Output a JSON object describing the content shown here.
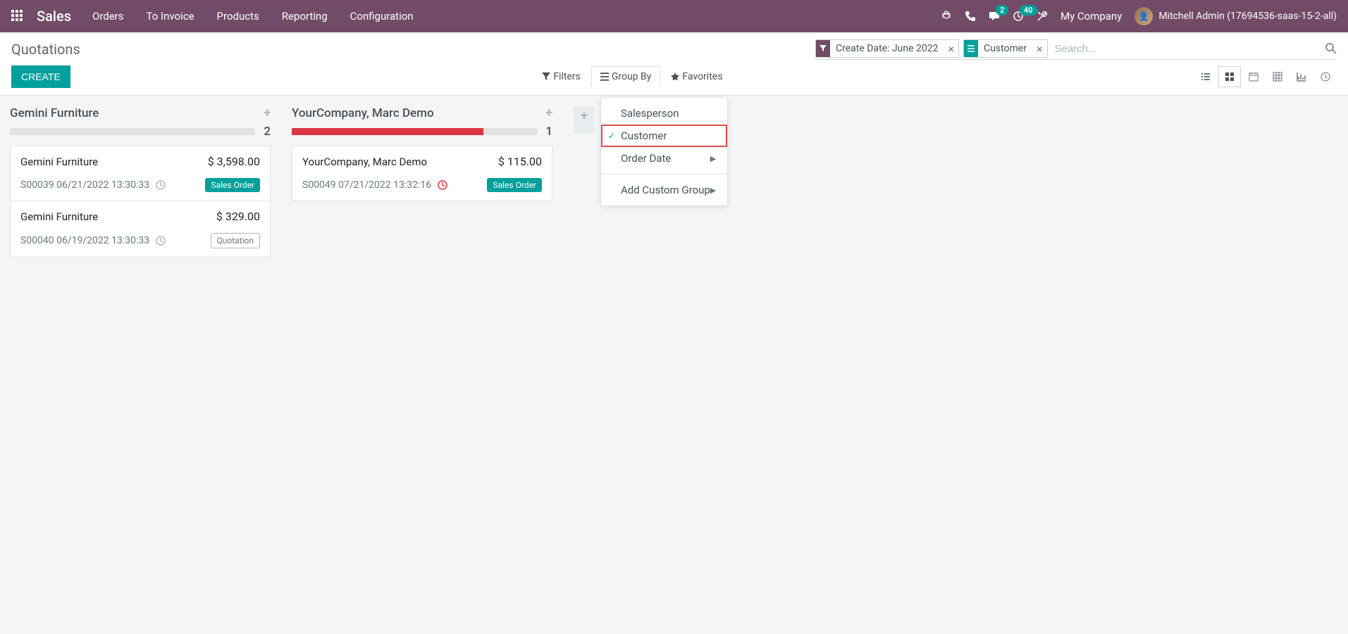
{
  "nav": {
    "brand": "Sales",
    "menu": [
      "Orders",
      "To Invoice",
      "Products",
      "Reporting",
      "Configuration"
    ],
    "messages_badge": "2",
    "activities_badge": "40",
    "company": "My Company",
    "user": "Mitchell Admin (17694536-saas-15-2-all)"
  },
  "control": {
    "title": "Quotations",
    "create": "CREATE",
    "filters": "Filters",
    "groupby": "Group By",
    "favorites": "Favorites",
    "search_placeholder": "Search...",
    "facets": [
      {
        "type": "filter",
        "label": "Create Date: June 2022"
      },
      {
        "type": "groupby",
        "label": "Customer"
      }
    ]
  },
  "dropdown": {
    "items": [
      {
        "label": "Salesperson",
        "checked": false,
        "caret": false
      },
      {
        "label": "Customer",
        "checked": true,
        "caret": false,
        "highlighted": true
      },
      {
        "label": "Order Date",
        "checked": false,
        "caret": true
      }
    ],
    "custom": "Add Custom Group"
  },
  "kanban": {
    "columns": [
      {
        "title": "Gemini Furniture",
        "count": "2",
        "bar_fill": 0,
        "cards": [
          {
            "title": "Gemini Furniture",
            "amount": "$ 3,598.00",
            "ref": "S00039 06/21/2022 13:30:33",
            "clock": "gray",
            "badge": "Sales Order",
            "badge_type": "success"
          },
          {
            "title": "Gemini Furniture",
            "amount": "$ 329.00",
            "ref": "S00040 06/19/2022 13:30:33",
            "clock": "gray",
            "badge": "Quotation",
            "badge_type": "outline"
          }
        ]
      },
      {
        "title": "YourCompany, Marc Demo",
        "count": "1",
        "bar_fill": 78,
        "cards": [
          {
            "title": "YourCompany, Marc Demo",
            "amount": "$ 115.00",
            "ref": "S00049 07/21/2022 13:32:16",
            "clock": "red",
            "badge": "Sales Order",
            "badge_type": "success"
          }
        ]
      }
    ]
  }
}
